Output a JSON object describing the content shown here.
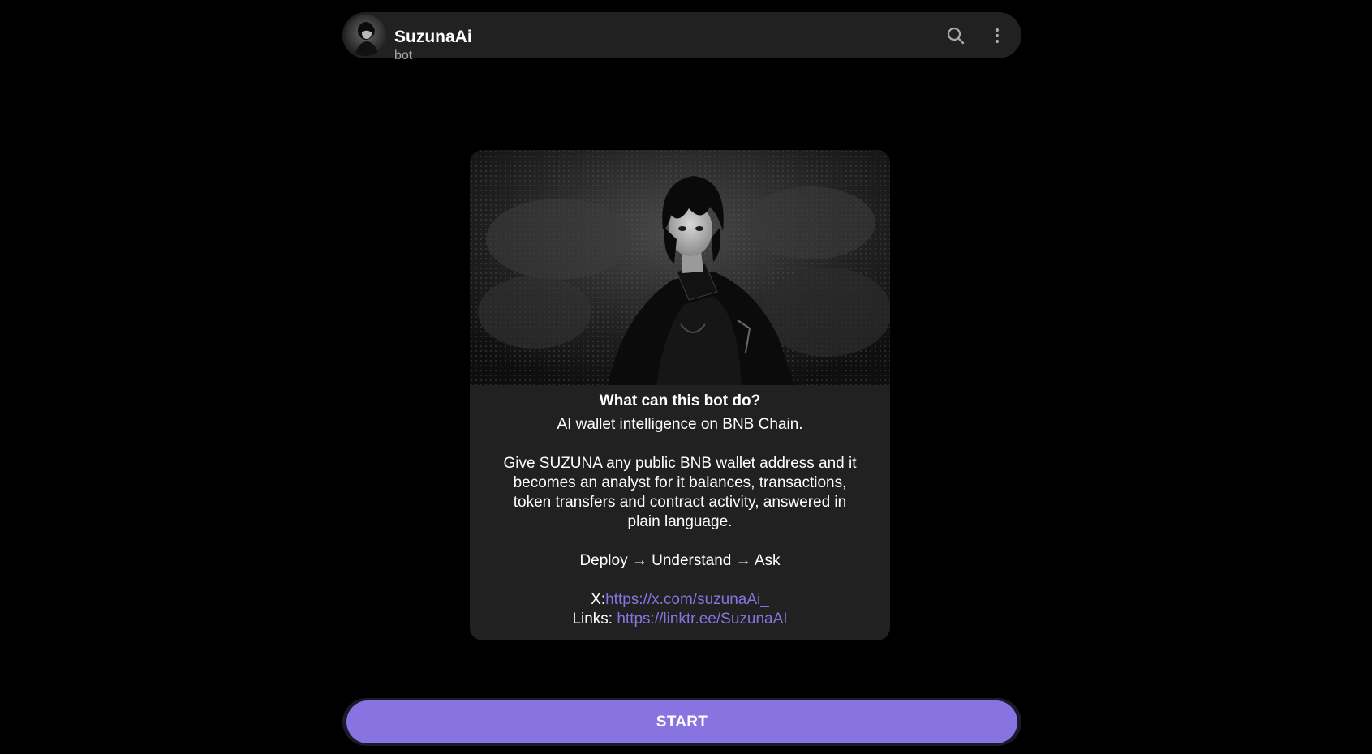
{
  "header": {
    "title": "SuzunaAi",
    "subtitle": "bot",
    "search_icon": "search-icon",
    "more_icon": "more-vertical-icon"
  },
  "card": {
    "heading": "What can this bot do?",
    "tagline": "AI wallet intelligence on BNB Chain.",
    "description_lines": [
      "Give SUZUNA any public BNB wallet address and it",
      "becomes an analyst for it balances, transactions,",
      "token transfers and contract activity, answered in",
      "plain language."
    ],
    "flow": "Deploy → Understand → Ask",
    "x_label": "X:",
    "x_link": "https://x.com/suzunaAi_",
    "links_label": "Links: ",
    "links_link": "https://linktr.ee/SuzunaAI"
  },
  "start_button": {
    "label": "START"
  },
  "colors": {
    "background": "#000000",
    "panel": "#212121",
    "accent": "#8774e1",
    "link": "#8774e1",
    "subtitle": "#aaaaaa"
  }
}
